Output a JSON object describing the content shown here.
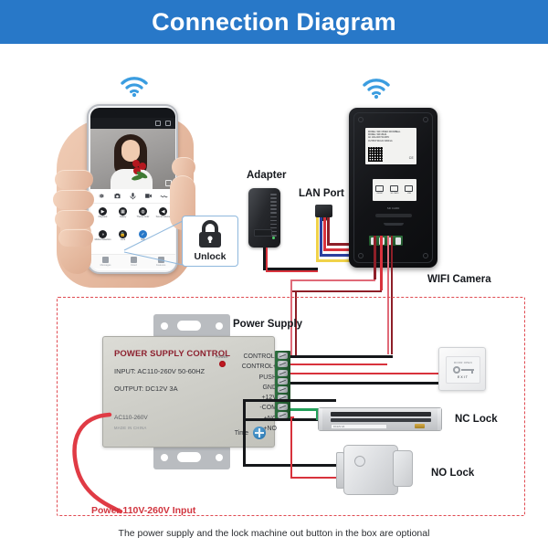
{
  "header": {
    "title": "Connection Diagram"
  },
  "phone": {
    "toolbar_icons": [
      "settings-icon",
      "camera-icon",
      "mic-icon",
      "video-icon",
      "wave-icon"
    ],
    "apps": [
      {
        "icon": "playback-icon",
        "label": "Playback"
      },
      {
        "icon": "gallery-icon",
        "label": "Gallery"
      },
      {
        "icon": "theme-icon",
        "label": "Theme Color"
      },
      {
        "icon": "sound-icon",
        "label": "Sound Volume"
      },
      {
        "icon": "motion-icon",
        "label": "Motion Detection"
      },
      {
        "icon": "lock-icon",
        "label": "Lock"
      },
      {
        "icon": "edit-icon",
        "label": "Edit"
      },
      {
        "icon": "blank-icon",
        "label": ""
      }
    ],
    "nav": [
      {
        "icon": "messages-icon",
        "label": "Messages"
      },
      {
        "icon": "cloud-icon",
        "label": "Cloud"
      },
      {
        "icon": "features-icon",
        "label": "Features"
      }
    ]
  },
  "callouts": {
    "unlock": "Unlock",
    "adapter": "Adapter",
    "lan_port": "LAN Port",
    "wifi_camera": "WIFI Camera",
    "power_supply": "Power Supply",
    "nc_lock": "NC Lock",
    "no_lock": "NO Lock"
  },
  "power_supply": {
    "title": "POWER SUPPLY CONTROL",
    "input": "INPUT: AC110-260V 50-60HZ",
    "output": "OUTPUT: DC12V  3A",
    "ac_rating": "AC110-260V",
    "made_in": "MADE IN CHINA",
    "power_led_label": "POWER",
    "time_label": "Time",
    "terminals": [
      "CONTROL-",
      "CONTROL+",
      "PUSH",
      "GND",
      "+12V",
      "-COM",
      "+NC",
      "+NO"
    ]
  },
  "camera": {
    "label_lines": [
      "MODEL: WIFI VIDEO DOORBELL",
      "MODEL:  WIFI-BL01",
      "AC 100-240V 50-60Hz",
      "OUTPUT:DC12V  2000mA"
    ],
    "certs": "CE",
    "made_in": "MADE IN CHINA",
    "panel_cells": [
      {
        "icon": "reset-icon",
        "label": "RESET"
      },
      {
        "icon": "sd-icon",
        "label": "SD CARD"
      },
      {
        "icon": "usb-icon",
        "label": "USB"
      }
    ],
    "slot_label": "SD CARD"
  },
  "exit_button": {
    "top_text": "DOOR OPEN",
    "label": "EXIT",
    "icon": "key-icon"
  },
  "footer": {
    "power_input": "Power 110V-260V Input",
    "note": "The power supply and the lock machine out button in the box are optional"
  },
  "colors": {
    "header_blue": "#2878c8",
    "accent_red": "#d1343e",
    "dashed_border": "#e04b52",
    "wifi_blue": "#3b9de0"
  }
}
